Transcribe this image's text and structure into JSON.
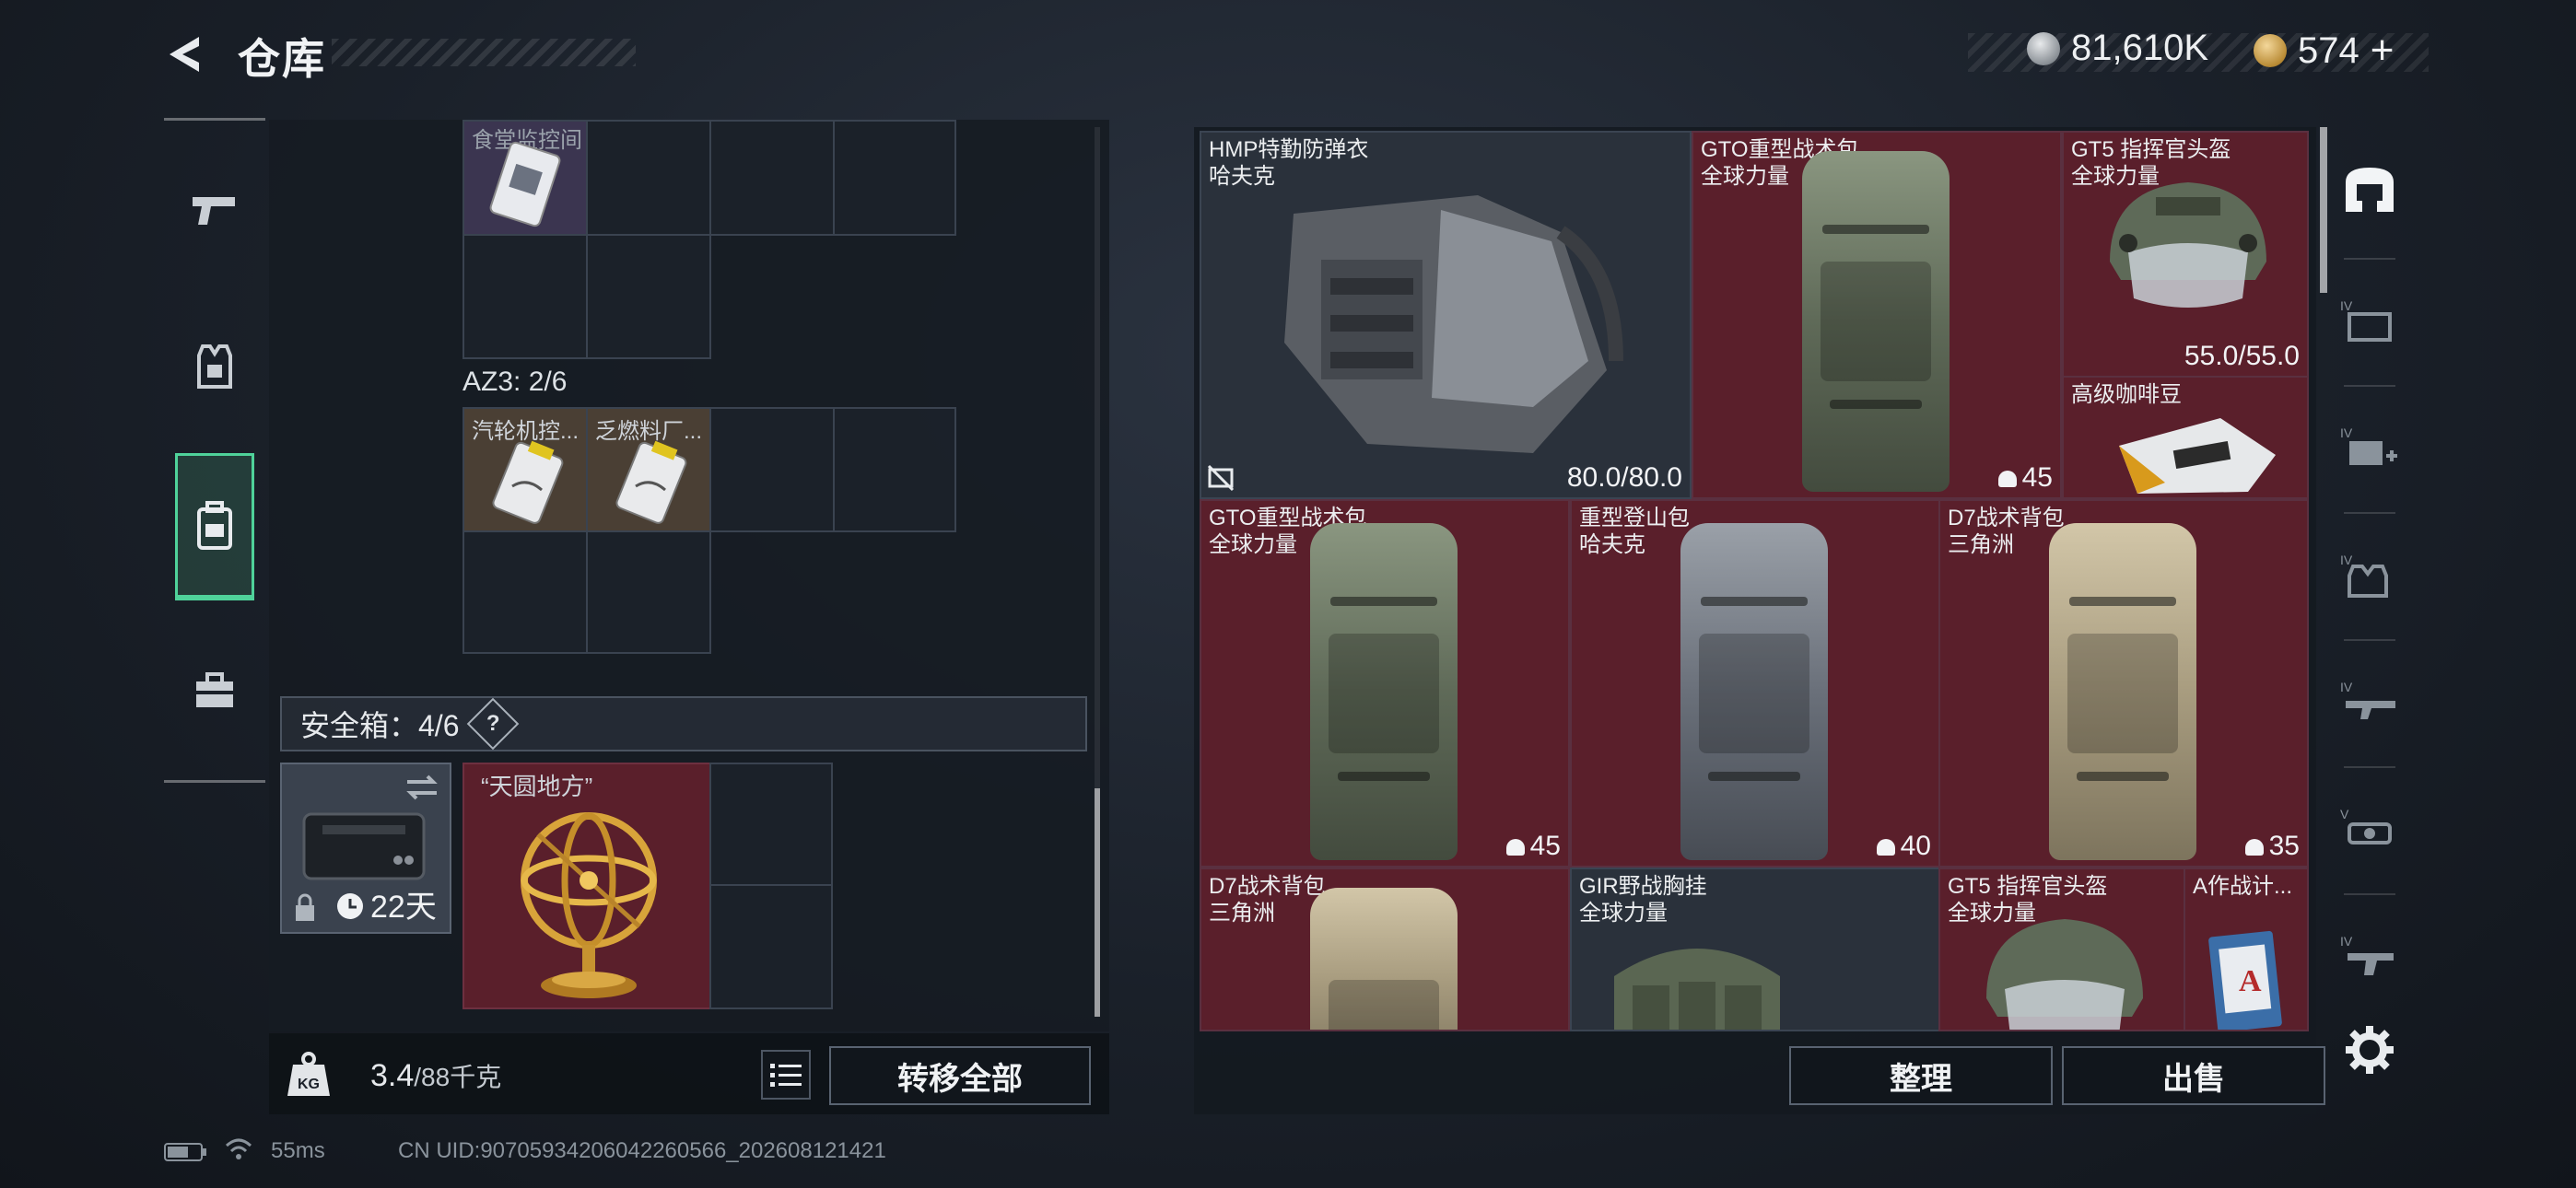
{
  "header": {
    "title": "仓库",
    "silver_amount": "81,610K",
    "gold_amount": "574",
    "plus": "+"
  },
  "left_nav": {
    "items": [
      {
        "icon": "pistol-icon",
        "active": false
      },
      {
        "icon": "armor-vest-icon",
        "active": false
      },
      {
        "icon": "backpack-icon",
        "active": true
      },
      {
        "icon": "medkit-case-icon",
        "active": false
      }
    ]
  },
  "container_top": {
    "partial_label": "食堂监控间"
  },
  "az3": {
    "label": "AZ3: 2/6",
    "items": [
      {
        "name": "汽轮机控..."
      },
      {
        "name": "乏燃料厂..."
      }
    ]
  },
  "safe_box": {
    "label": "安全箱：4/6",
    "help": "?",
    "days": "22天",
    "item_name": "“天圆地方”"
  },
  "weight": {
    "current": "3.4",
    "max": "/88千克",
    "kg_icon_label": "KG"
  },
  "buttons": {
    "transfer_all": "转移全部",
    "organize": "整理",
    "sell": "出售"
  },
  "stash_items": [
    {
      "name": "HMP特勤防弹衣",
      "brand": "哈夫克",
      "value": "80.0/80.0"
    },
    {
      "name": "GTO重型战术包",
      "brand": "全球力量",
      "value": "45"
    },
    {
      "name": "GT5 指挥官头盔",
      "brand": "全球力量",
      "value": "55.0/55.0"
    },
    {
      "name": "高级咖啡豆",
      "brand": "",
      "value": ""
    },
    {
      "name": "GTO重型战术包",
      "brand": "全球力量",
      "value": "45"
    },
    {
      "name": "重型登山包",
      "brand": "哈夫克",
      "value": "40"
    },
    {
      "name": "D7战术背包",
      "brand": "三角洲",
      "value": "35"
    },
    {
      "name": "D7战术背包",
      "brand": "三角洲",
      "value": ""
    },
    {
      "name": "GIR野战胸挂",
      "brand": "全球力量",
      "value": ""
    },
    {
      "name": "GT5 指挥官头盔",
      "brand": "全球力量",
      "value": ""
    },
    {
      "name": "A作战计...",
      "brand": "",
      "value": ""
    }
  ],
  "right_nav": {
    "items": [
      "backpack-active-icon",
      "tier4-case-icon",
      "tier4-medkit-icon",
      "tier4-armor-icon",
      "tier4-rifle-icon",
      "tier5-optic-icon",
      "tier4-grip-icon",
      "settings-gear-icon"
    ]
  },
  "status_bar": {
    "ping": "55ms",
    "uid": "CN UID:9070593420604​2260566_202608121421"
  },
  "colors": {
    "accent_green": "#4fd29a",
    "item_red": "#5a1f2b"
  }
}
